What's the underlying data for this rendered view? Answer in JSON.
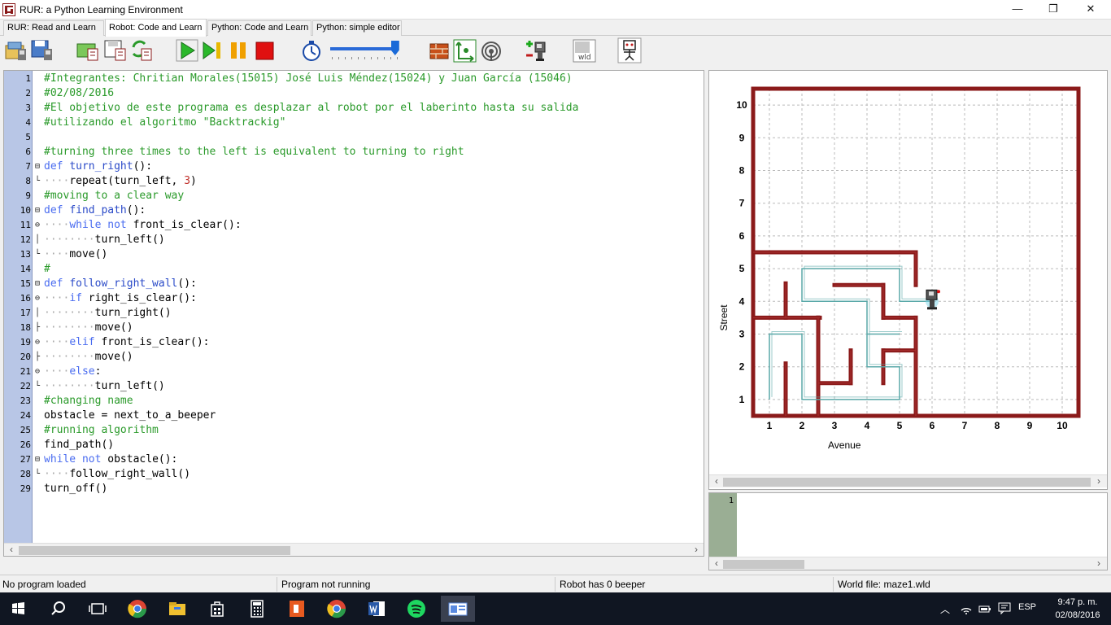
{
  "window": {
    "title": "RUR: a Python Learning Environment",
    "minimize": "—",
    "maximize": "❐",
    "close": "✕"
  },
  "tabs": [
    {
      "label": "RUR: Read and Learn"
    },
    {
      "label": "Robot: Code and Learn"
    },
    {
      "label": "Python: Code and Learn"
    },
    {
      "label": "Python: simple editor"
    }
  ],
  "active_tab": "Robot: Code and Learn",
  "toolbar": {
    "icons": [
      "open-world-icon",
      "save-world-icon",
      "open-program-icon",
      "save-program-icon",
      "reload-program-icon",
      "run-icon",
      "step-icon",
      "pause-icon",
      "stop-icon",
      "timer-icon",
      "speed-slider",
      "walls-icon",
      "resize-world-icon",
      "beepers-icon",
      "add-robot-icon",
      "world-file-icon",
      "robot-icon"
    ],
    "world_file_label": "wld",
    "speed_level": 0.95
  },
  "editor": {
    "lines": [
      {
        "n": "1",
        "fold": "",
        "segs": [
          {
            "t": "#Integrantes: Chritian Morales(15015) José Luis Méndez(15024) y Juan García (15046)",
            "c": "cm"
          }
        ]
      },
      {
        "n": "2",
        "fold": "",
        "segs": [
          {
            "t": "#02/08/2016",
            "c": "cm"
          }
        ]
      },
      {
        "n": "3",
        "fold": "",
        "segs": [
          {
            "t": "#El objetivo de este programa es desplazar al robot por el laberinto hasta su salida",
            "c": "cm"
          }
        ]
      },
      {
        "n": "4",
        "fold": "",
        "segs": [
          {
            "t": "#utilizando el algoritmo \"Backtrackig\"",
            "c": "cm"
          }
        ]
      },
      {
        "n": "5",
        "fold": "",
        "segs": []
      },
      {
        "n": "6",
        "fold": "",
        "segs": [
          {
            "t": "#turning three times to the left is equivalent to turning to right",
            "c": "cm"
          }
        ]
      },
      {
        "n": "7",
        "fold": "⊟",
        "segs": [
          {
            "t": "def ",
            "c": "kw"
          },
          {
            "t": "turn_right",
            "c": "fn"
          },
          {
            "t": "():",
            "c": ""
          }
        ]
      },
      {
        "n": "8",
        "fold": "└",
        "segs": [
          {
            "t": "    ",
            "c": "ws"
          },
          {
            "t": "repeat(turn_left, ",
            "c": ""
          },
          {
            "t": "3",
            "c": "num"
          },
          {
            "t": ")",
            "c": ""
          }
        ]
      },
      {
        "n": "9",
        "fold": "",
        "segs": [
          {
            "t": "#moving to a clear way",
            "c": "cm"
          }
        ]
      },
      {
        "n": "10",
        "fold": "⊟",
        "segs": [
          {
            "t": "def ",
            "c": "kw"
          },
          {
            "t": "find_path",
            "c": "fn"
          },
          {
            "t": "():",
            "c": ""
          }
        ]
      },
      {
        "n": "11",
        "fold": "⊖",
        "segs": [
          {
            "t": "    ",
            "c": "ws"
          },
          {
            "t": "while not ",
            "c": "kw"
          },
          {
            "t": "front_is_clear():",
            "c": ""
          }
        ]
      },
      {
        "n": "12",
        "fold": "│",
        "segs": [
          {
            "t": "        ",
            "c": "ws"
          },
          {
            "t": "turn_left()",
            "c": ""
          }
        ]
      },
      {
        "n": "13",
        "fold": "└",
        "segs": [
          {
            "t": "    ",
            "c": "ws"
          },
          {
            "t": "move()",
            "c": ""
          }
        ]
      },
      {
        "n": "14",
        "fold": "",
        "segs": [
          {
            "t": "#",
            "c": "cm"
          }
        ]
      },
      {
        "n": "15",
        "fold": "⊟",
        "segs": [
          {
            "t": "def ",
            "c": "kw"
          },
          {
            "t": "follow_right_wall",
            "c": "fn"
          },
          {
            "t": "():",
            "c": ""
          }
        ]
      },
      {
        "n": "16",
        "fold": "⊖",
        "segs": [
          {
            "t": "    ",
            "c": "ws"
          },
          {
            "t": "if ",
            "c": "kw"
          },
          {
            "t": "right_is_clear():",
            "c": ""
          }
        ]
      },
      {
        "n": "17",
        "fold": "│",
        "segs": [
          {
            "t": "        ",
            "c": "ws"
          },
          {
            "t": "turn_right()",
            "c": ""
          }
        ]
      },
      {
        "n": "18",
        "fold": "├",
        "segs": [
          {
            "t": "        ",
            "c": "ws"
          },
          {
            "t": "move()",
            "c": ""
          }
        ]
      },
      {
        "n": "19",
        "fold": "⊖",
        "segs": [
          {
            "t": "    ",
            "c": "ws"
          },
          {
            "t": "elif ",
            "c": "kw"
          },
          {
            "t": "front_is_clear():",
            "c": ""
          }
        ]
      },
      {
        "n": "20",
        "fold": "├",
        "segs": [
          {
            "t": "        ",
            "c": "ws"
          },
          {
            "t": "move()",
            "c": ""
          }
        ]
      },
      {
        "n": "21",
        "fold": "⊖",
        "segs": [
          {
            "t": "    ",
            "c": "ws"
          },
          {
            "t": "else",
            "c": "kw"
          },
          {
            "t": ":",
            "c": ""
          }
        ]
      },
      {
        "n": "22",
        "fold": "└",
        "segs": [
          {
            "t": "        ",
            "c": "ws"
          },
          {
            "t": "turn_left()",
            "c": ""
          }
        ]
      },
      {
        "n": "23",
        "fold": "",
        "segs": [
          {
            "t": "#changing name",
            "c": "cm"
          }
        ]
      },
      {
        "n": "24",
        "fold": "",
        "segs": [
          {
            "t": "obstacle = next_to_a_beeper",
            "c": ""
          }
        ]
      },
      {
        "n": "25",
        "fold": "",
        "segs": [
          {
            "t": "#running algorithm",
            "c": "cm"
          }
        ]
      },
      {
        "n": "26",
        "fold": "",
        "segs": [
          {
            "t": "find_path()",
            "c": ""
          }
        ]
      },
      {
        "n": "27",
        "fold": "⊟",
        "segs": [
          {
            "t": "while not ",
            "c": "kw"
          },
          {
            "t": "obstacle():",
            "c": ""
          }
        ]
      },
      {
        "n": "28",
        "fold": "└",
        "segs": [
          {
            "t": "    ",
            "c": "ws"
          },
          {
            "t": "follow_right_wall()",
            "c": ""
          }
        ]
      },
      {
        "n": "29",
        "fold": "",
        "segs": [
          {
            "t": "turn_off()",
            "c": ""
          }
        ]
      }
    ]
  },
  "world": {
    "avenue_label": "Avenue",
    "street_label": "Street",
    "avenues": [
      "1",
      "2",
      "3",
      "4",
      "5",
      "6",
      "7",
      "8",
      "9",
      "10"
    ],
    "streets": [
      "1",
      "2",
      "3",
      "4",
      "5",
      "6",
      "7",
      "8",
      "9",
      "10"
    ],
    "robot": {
      "avenue": 6,
      "street": 4,
      "facing": "east"
    },
    "colors": {
      "wall": "#8b1a1a",
      "trace": "#5aa8a8",
      "grid": "#bbbbbb"
    }
  },
  "output": {
    "line_number": "1"
  },
  "status": {
    "program": "No program loaded",
    "running": "Program not running",
    "beepers": "Robot has 0 beeper",
    "world_file": "World file: maze1.wld"
  },
  "taskbar": {
    "time": "9:47 p. m.",
    "date": "02/08/2016",
    "language": "ESP",
    "apps": [
      "start-icon",
      "search-icon",
      "task-view-icon",
      "chrome-icon",
      "file-explorer-icon",
      "store-icon",
      "calculator-icon",
      "office-icon",
      "chrome-icon",
      "word-icon",
      "spotify-icon",
      "rur-app-icon"
    ]
  }
}
